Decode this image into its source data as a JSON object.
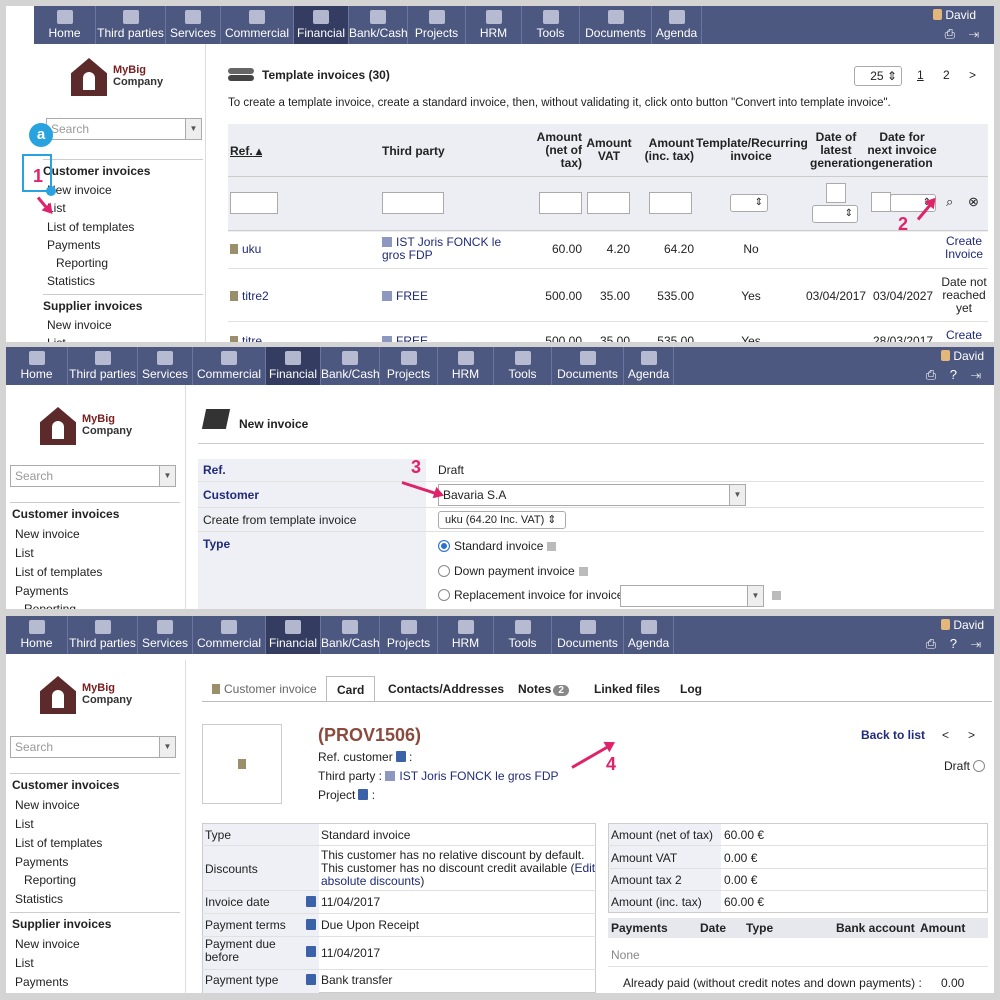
{
  "nav": {
    "items": [
      "Home",
      "Third parties",
      "Services",
      "Commercial",
      "Financial",
      "Bank/Cash",
      "Projects",
      "HRM",
      "Tools",
      "Documents",
      "Agenda"
    ],
    "active": "Financial",
    "user": "David"
  },
  "company": {
    "name_line1": "MyBig",
    "name_line2": "Company"
  },
  "sidebar": {
    "search_placeholder": "Search",
    "customer_header": "Customer invoices",
    "items": [
      "New invoice",
      "List",
      "List of templates",
      "Payments",
      "Reporting",
      "Statistics"
    ],
    "supplier_header": "Supplier invoices",
    "supplier_items": [
      "New invoice",
      "List",
      "Payments"
    ]
  },
  "panel1": {
    "title": "Template invoices (30)",
    "per_page": "25",
    "pages": [
      "1",
      "2",
      ">"
    ],
    "instruction": "To create a template invoice, create a standard invoice, then, without validating it, click onto button \"Convert into template invoice\".",
    "headers": {
      "ref": "Ref.",
      "third_party": "Third party",
      "amount_net_1": "Amount",
      "amount_net_2": "(net of",
      "amount_net_3": "tax)",
      "amount_vat_1": "Amount",
      "amount_vat_2": "VAT",
      "amount_inc_1": "Amount",
      "amount_inc_2": "(inc. tax)",
      "template_1": "Template/Recurring",
      "template_2": "invoice",
      "latest_1": "Date of",
      "latest_2": "latest",
      "latest_3": "generation",
      "next_1": "Date for",
      "next_2": "next invoice",
      "next_3": "generation"
    },
    "rows": [
      {
        "ref": "uku",
        "third_1": "IST Joris FONCK le",
        "third_2": "gros FDP",
        "net": "60.00",
        "vat": "4.20",
        "inc": "64.20",
        "recurring": "No",
        "latest": "",
        "next": "",
        "action_1": "Create",
        "action_2": "Invoice"
      },
      {
        "ref": "titre2",
        "third_1": "FREE",
        "third_2": "",
        "net": "500.00",
        "vat": "35.00",
        "inc": "535.00",
        "recurring": "Yes",
        "latest": "03/04/2017",
        "next": "03/04/2027",
        "action_1": "Date not",
        "action_2": "reached",
        "action_3": "yet"
      },
      {
        "ref": "titre",
        "third_1": "FREE",
        "third_2": "",
        "net": "500.00",
        "vat": "35.00",
        "inc": "535.00",
        "recurring": "Yes",
        "latest": "",
        "next": "28/03/2017",
        "action_1": "Create",
        "action_2": ""
      }
    ]
  },
  "panel2": {
    "title": "New invoice",
    "ref_label": "Ref.",
    "ref_value": "Draft",
    "customer_label": "Customer",
    "customer_value": "Bavaria S.A",
    "template_label": "Create from template invoice",
    "template_value": "uku (64.20 Inc. VAT)",
    "type_label": "Type",
    "types": [
      "Standard invoice",
      "Down payment invoice",
      "Replacement invoice for invoice"
    ]
  },
  "panel3": {
    "tabs": [
      "Customer invoice",
      "Card",
      "Contacts/Addresses",
      "Notes",
      "Linked files",
      "Log"
    ],
    "notes_count": "2",
    "ref": "(PROV1506)",
    "ref_customer": "Ref. customer",
    "third_party_label": "Third party :",
    "third_party": "IST Joris FONCK le gros FDP",
    "project": "Project",
    "back": "Back to list",
    "status": "Draft",
    "fields": [
      {
        "label": "Type",
        "value": "Standard invoice"
      },
      {
        "label": "Discounts",
        "value_1": "This customer has no relative discount by default.",
        "value_2": "This customer has no discount credit available (",
        "link_1": "Edit",
        "link_2": "absolute discounts",
        ")": ")"
      },
      {
        "label": "Invoice date",
        "value": "11/04/2017"
      },
      {
        "label": "Payment terms",
        "value": "Due Upon Receipt"
      },
      {
        "label_1": "Payment due",
        "label_2": "before",
        "value": "11/04/2017"
      },
      {
        "label": "Payment type",
        "value": "Bank transfer"
      }
    ],
    "amounts": [
      {
        "label": "Amount (net of tax)",
        "value": "60.00 €"
      },
      {
        "label": "Amount VAT",
        "value": "0.00 €"
      },
      {
        "label": "Amount tax 2",
        "value": "0.00 €"
      },
      {
        "label": "Amount (inc. tax)",
        "value": "60.00 €"
      }
    ],
    "payments_headers": [
      "Payments",
      "Date",
      "Type",
      "Bank account",
      "Amount"
    ],
    "payments_none": "None",
    "already_paid": "Already paid (without credit notes and down payments) :",
    "already_paid_value": "0.00"
  },
  "annotations": [
    "1",
    "2",
    "3",
    "4",
    "a"
  ],
  "colors": {
    "topbar": "#4d5880",
    "accent": "#e0226a",
    "link": "#202a7a"
  }
}
